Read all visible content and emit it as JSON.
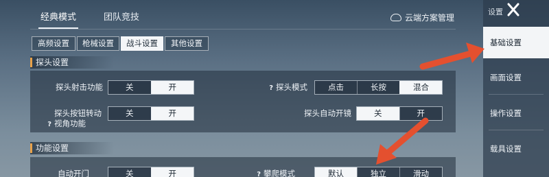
{
  "mode_tabs": [
    "经典模式",
    "团队竞技"
  ],
  "cloud_label": "云端方案管理",
  "sub_tabs": [
    "高频设置",
    "枪械设置",
    "战斗设置",
    "其他设置"
  ],
  "sections": {
    "peek": {
      "title": "探头设置",
      "peek_fire": {
        "label": "探头射击功能",
        "options": [
          "关",
          "开"
        ],
        "selected": "开"
      },
      "peek_mode": {
        "label": "探头模式",
        "options": [
          "点击",
          "长按",
          "混合"
        ],
        "selected": "混合"
      },
      "peek_view": {
        "label": "探头按钮转动视角功能",
        "options": [
          "关",
          "开"
        ],
        "selected": "开"
      },
      "peek_scope": {
        "label": "探头自动开镜",
        "options": [
          "关",
          "开"
        ],
        "selected": "关"
      }
    },
    "function": {
      "title": "功能设置",
      "auto_door": {
        "label": "自动开门",
        "options": [
          "关",
          "开"
        ],
        "selected": "开"
      },
      "climb_mode": {
        "label": "攀爬模式",
        "options": [
          "默认",
          "独立",
          "滑动"
        ],
        "selected": "默认"
      }
    }
  },
  "side": {
    "title": "设置",
    "items": [
      "基础设置",
      "画面设置",
      "操作设置",
      "载具设置"
    ],
    "active": "基础设置"
  },
  "colors": {
    "arrow": "#e4502f",
    "accent": "#e7a14a"
  }
}
